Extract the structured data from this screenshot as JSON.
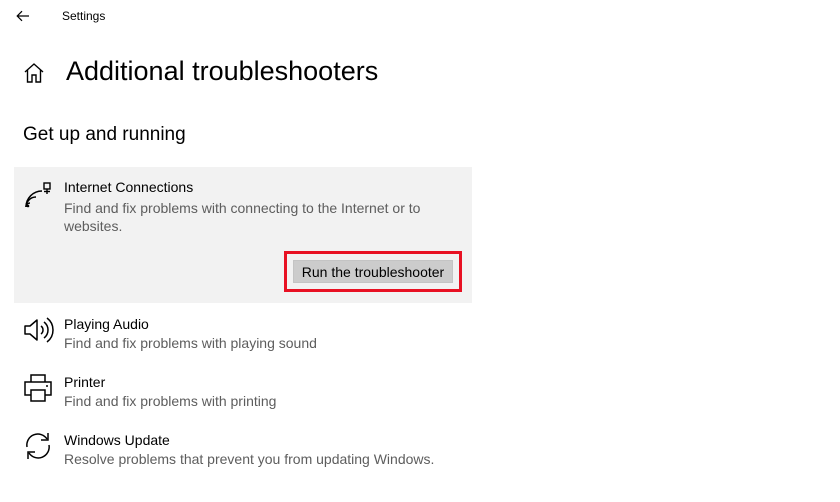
{
  "window": {
    "app_title": "Settings"
  },
  "header": {
    "page_title": "Additional troubleshooters"
  },
  "section": {
    "title": "Get up and running"
  },
  "troubleshooters": [
    {
      "name": "Internet Connections",
      "description": "Find and fix problems with connecting to the Internet or to websites.",
      "icon": "wifi-icon",
      "expanded": true,
      "button_label": "Run the troubleshooter"
    },
    {
      "name": "Playing Audio",
      "description": "Find and fix problems with playing sound",
      "icon": "speaker-icon"
    },
    {
      "name": "Printer",
      "description": "Find and fix problems with printing",
      "icon": "printer-icon"
    },
    {
      "name": "Windows Update",
      "description": "Resolve problems that prevent you from updating Windows.",
      "icon": "sync-icon"
    }
  ],
  "colors": {
    "highlight_border": "#e81123",
    "expanded_bg": "#f2f2f2",
    "button_bg": "#cccccc",
    "secondary_text": "#5d5d5d"
  }
}
